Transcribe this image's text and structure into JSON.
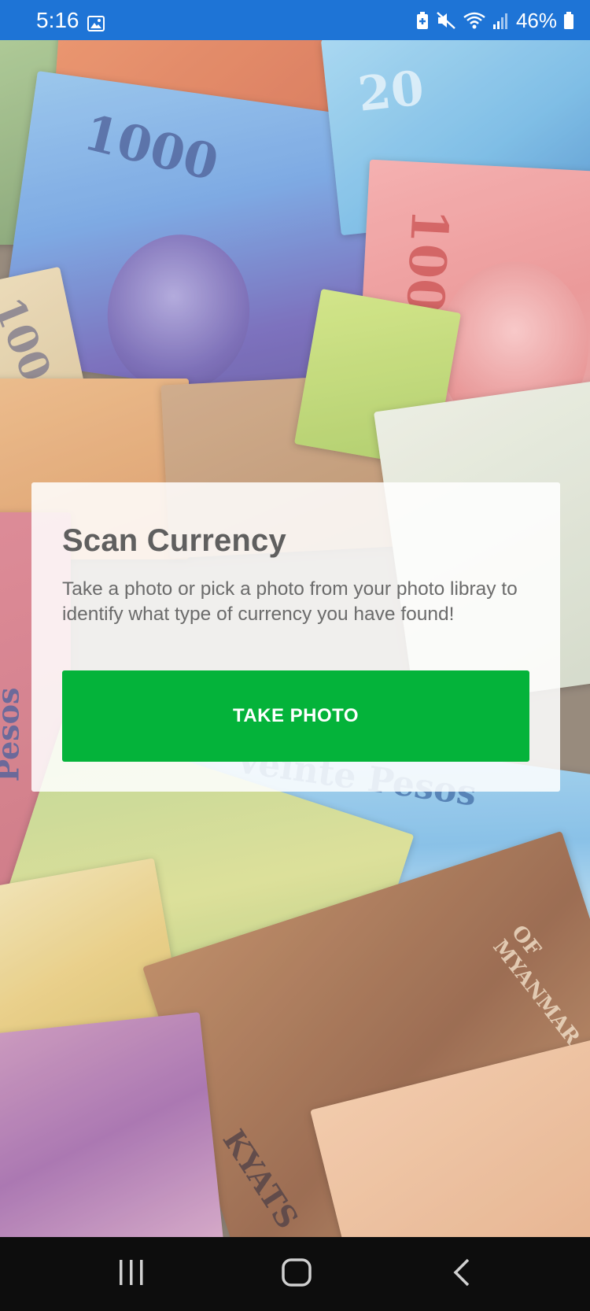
{
  "status_bar": {
    "time": "5:16",
    "battery_percent": "46%",
    "background_color": "#1e74d6",
    "icons": [
      "gallery-icon",
      "battery-saver-icon",
      "mute-icon",
      "wifi-icon",
      "signal-icon",
      "battery-icon"
    ]
  },
  "card": {
    "title": "Scan Currency",
    "description": "Take a photo or pick a photo from your photo libray to identify what type of currency you have found!",
    "button_label": "TAKE PHOTO",
    "button_color": "#04b33a"
  },
  "background": {
    "bill_labels": [
      "1000",
      "20",
      "1000",
      "100",
      "Veinte Pesos",
      "Pesos",
      "KYATS",
      "OF MYANMAR"
    ]
  },
  "nav_bar": {
    "icons": [
      "recent-apps-icon",
      "home-icon",
      "back-icon"
    ]
  }
}
